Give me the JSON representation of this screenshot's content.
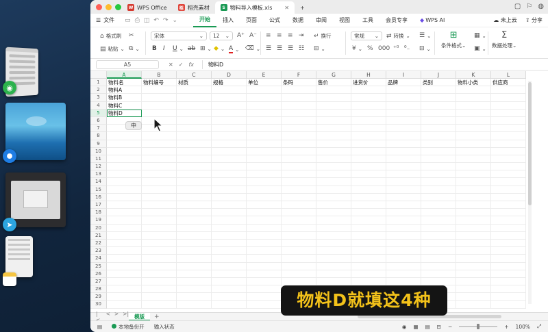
{
  "window": {
    "tabs": [
      {
        "label": "WPS Office",
        "color": "#d63a2f",
        "icon": "W"
      },
      {
        "label": "稻壳素材",
        "color": "#e0463c",
        "icon": "稻"
      },
      {
        "label": "物料导入模板.xls",
        "color": "#1a9a54",
        "icon": "S"
      }
    ],
    "new_tab": "+"
  },
  "menubar": {
    "file": "文件",
    "items": [
      "开始",
      "插入",
      "页面",
      "公式",
      "数据",
      "审阅",
      "视图",
      "工具",
      "会员专享",
      "WPS AI"
    ],
    "active": "开始",
    "cloud": "未上云",
    "share": "分享"
  },
  "ribbon": {
    "format_painter": "格式刷",
    "paste": "粘贴",
    "font_name": "宋体",
    "font_size": "12",
    "wrap": "换行",
    "number_format": "常规",
    "convert": "转换",
    "cond_format": "条件格式",
    "data_process": "数据处理"
  },
  "formula_bar": {
    "cell_ref": "A5",
    "fx": "fx",
    "content": "物料D"
  },
  "grid": {
    "columns": [
      "A",
      "B",
      "C",
      "D",
      "E",
      "F",
      "G",
      "H",
      "I",
      "J",
      "K",
      "L"
    ],
    "header_row": [
      "物料名",
      "物料编号",
      "材质",
      "规格",
      "单位",
      "条码",
      "售价",
      "进货价",
      "品牌",
      "类别",
      "物料小类",
      "供应商"
    ],
    "data_rows": [
      [
        "物料A"
      ],
      [
        "物料B"
      ],
      [
        "物料C"
      ],
      [
        "物料D"
      ]
    ],
    "row_count": 30,
    "active_cell": {
      "col": "A",
      "row": 5
    }
  },
  "ime_hint": "中",
  "sheets": {
    "active": "模版",
    "nav": [
      "|<",
      "<",
      ">",
      ">|"
    ]
  },
  "status": {
    "backup": "本地备份开",
    "input_state": "输入状态",
    "zoom": "100%"
  },
  "subtitle": "物料D就填这4种",
  "colors": {
    "accent": "#1a9a54",
    "subtitle_text": "#f3c21a",
    "subtitle_bg": "#141414"
  }
}
